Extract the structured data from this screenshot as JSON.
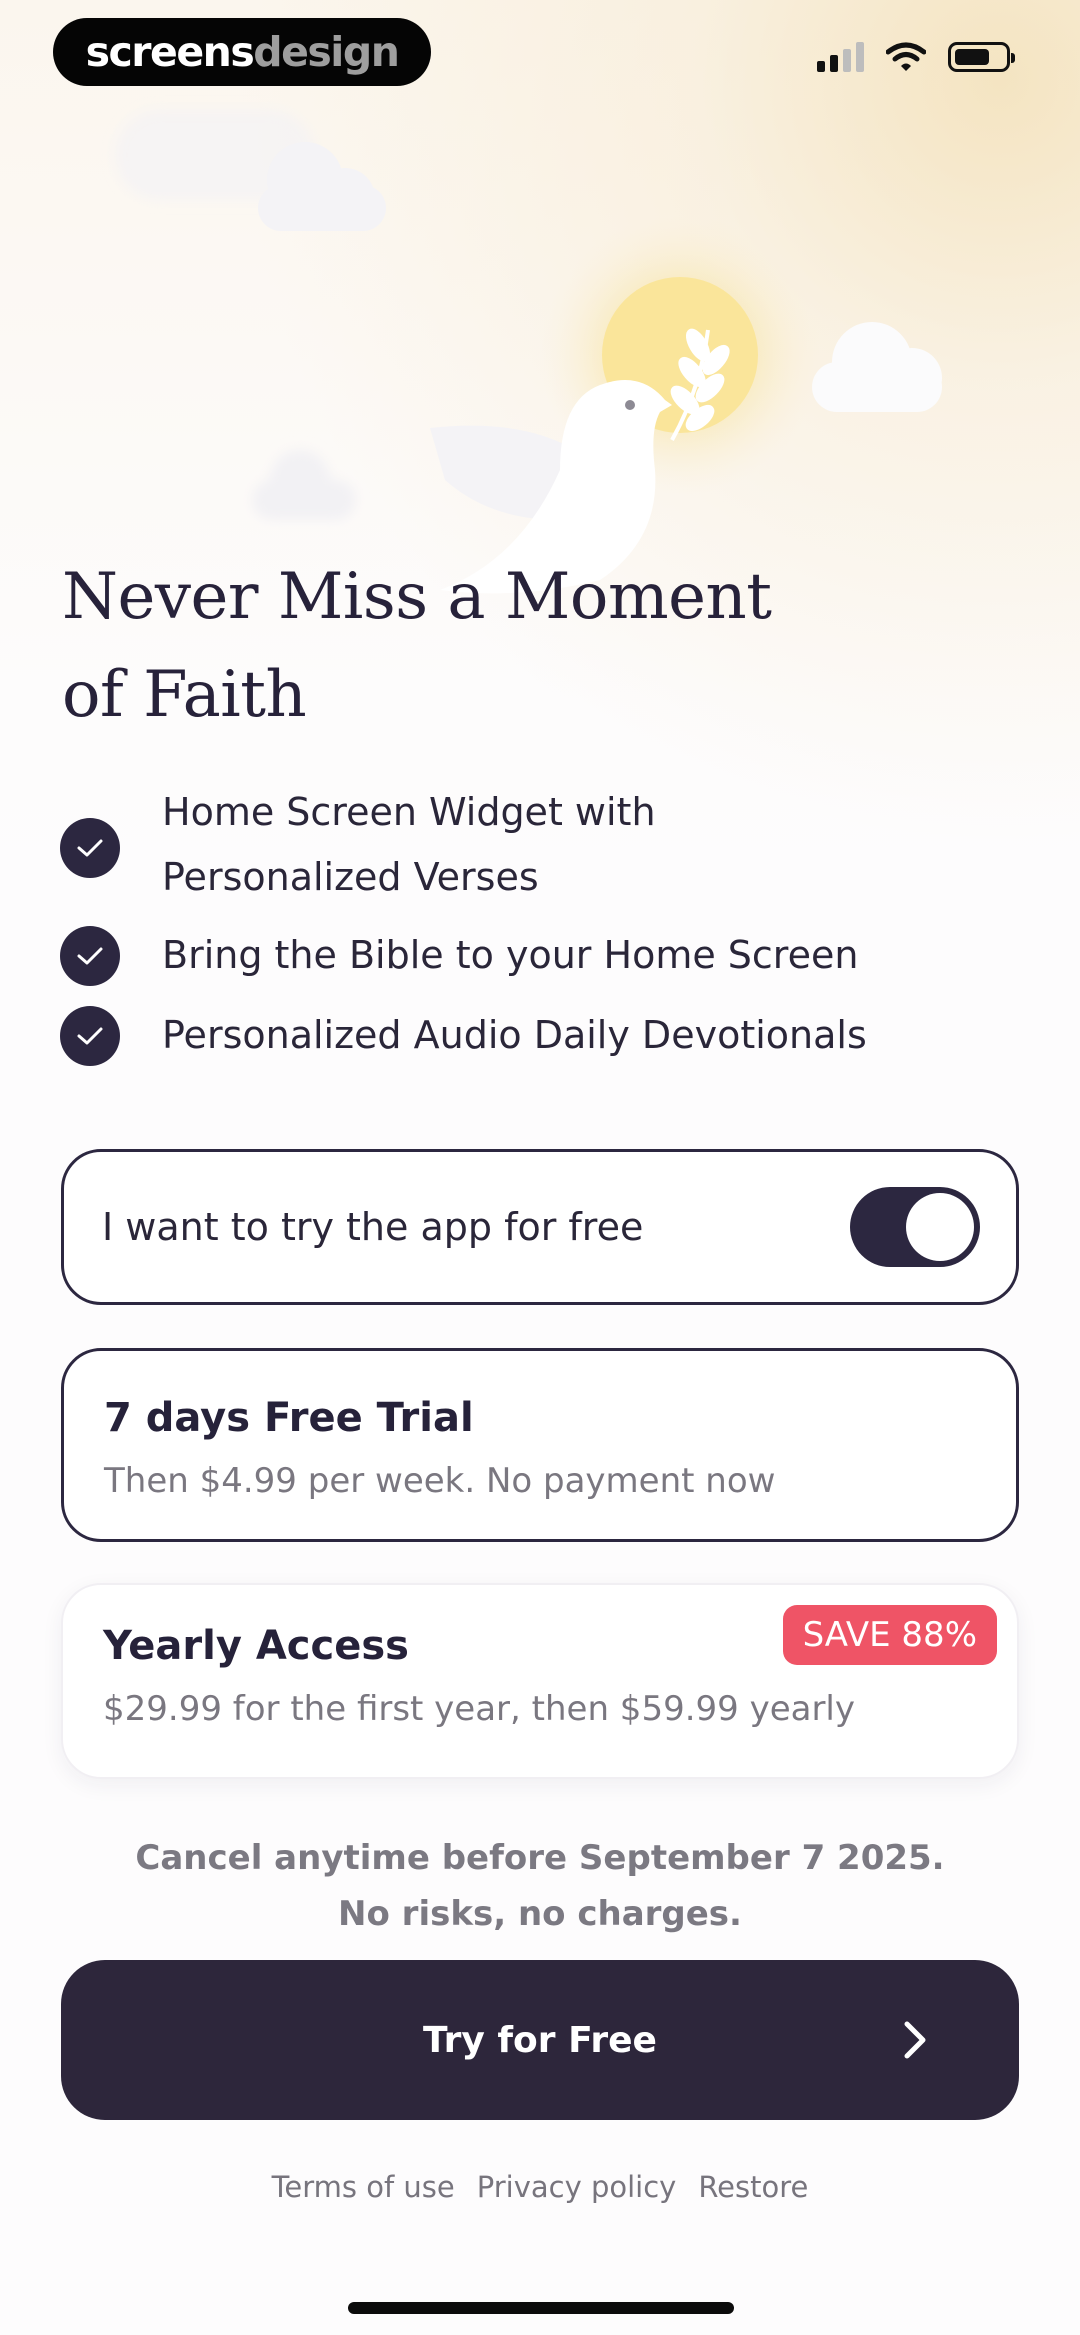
{
  "brand": {
    "part1": "screens",
    "part2": "design"
  },
  "status_bar": {
    "signal_icon": "cellular-signal-icon",
    "wifi_icon": "wifi-icon",
    "battery_icon": "battery-icon",
    "signal_bars_active": 2,
    "signal_bars_total": 4,
    "battery_level": 0.6
  },
  "illustration": {
    "icon": "dove-with-olive-branch-icon"
  },
  "headline": {
    "line1": "Never Miss a Moment",
    "line2": "of Faith"
  },
  "features": [
    {
      "icon": "check-icon",
      "line1": "Home Screen Widget with",
      "line2": "Personalized Verses"
    },
    {
      "icon": "check-icon",
      "line1": "Bring the Bible to your Home Screen",
      "line2": ""
    },
    {
      "icon": "check-icon",
      "line1": "Personalized Audio Daily Devotionals",
      "line2": ""
    }
  ],
  "free_trial_toggle": {
    "label": "I want to try the app for free",
    "enabled": true
  },
  "plans": [
    {
      "name": "7 days Free Trial",
      "description": "Then $4.99 per week. No payment now",
      "selected": true,
      "badge": ""
    },
    {
      "name": "Yearly Access",
      "description": "$29.99 for the first year, then $59.99 yearly",
      "selected": false,
      "badge": "SAVE 88%"
    }
  ],
  "cancel_note": {
    "line1": "Cancel anytime before September 7 2025.",
    "line2": "No risks, no charges."
  },
  "cta": {
    "label": "Try for Free",
    "icon": "chevron-right-icon"
  },
  "footer_links": [
    "Terms of use",
    "Privacy policy",
    "Restore"
  ],
  "colors": {
    "primary_dark": "#2C2740",
    "badge_red": "#EF5466",
    "muted_text": "#7A7780",
    "sun_yellow": "#FAE59A"
  }
}
